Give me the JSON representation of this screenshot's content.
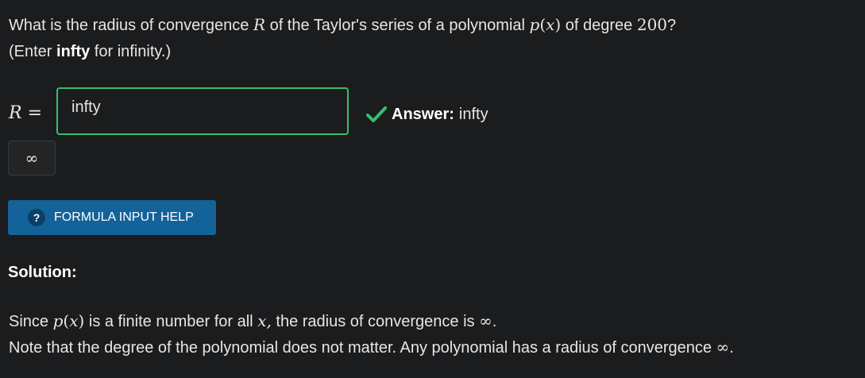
{
  "question": {
    "line1_a": "What is the radius of convergence ",
    "var_R": "R",
    "line1_b": " of the Taylor's series of a polynomial ",
    "var_p": "p",
    "open_paren": "(",
    "var_x": "x",
    "close_paren": ")",
    "line1_c": " of degree ",
    "degree": "200",
    "line1_d": "?",
    "line2_a": "(Enter ",
    "line2_bold": "infty",
    "line2_b": " for infinity.)"
  },
  "answer_row": {
    "label_var": "R",
    "label_eq": " =",
    "input_value": "infty",
    "feedback_label": "Answer:",
    "feedback_value": "infty",
    "status_color": "#35c06b"
  },
  "infinity_button": {
    "symbol": "∞"
  },
  "help_button": {
    "icon": "?",
    "label": "FORMULA INPUT HELP",
    "color": "#136299"
  },
  "solution": {
    "heading": "Solution:",
    "line1_a": "Since ",
    "var_p": "p",
    "open_paren": "(",
    "var_x": "x",
    "close_paren": ")",
    "line1_b": " is a finite number for all ",
    "var_x2": "x,",
    "line1_c": "  the radius of convergence is ",
    "infinity": "∞",
    "line1_d": ".",
    "line2_a": "Note that the degree of the polynomial does not matter. Any polynomial has a radius of convergence  ",
    "infinity2": "∞",
    "line2_b": "."
  }
}
